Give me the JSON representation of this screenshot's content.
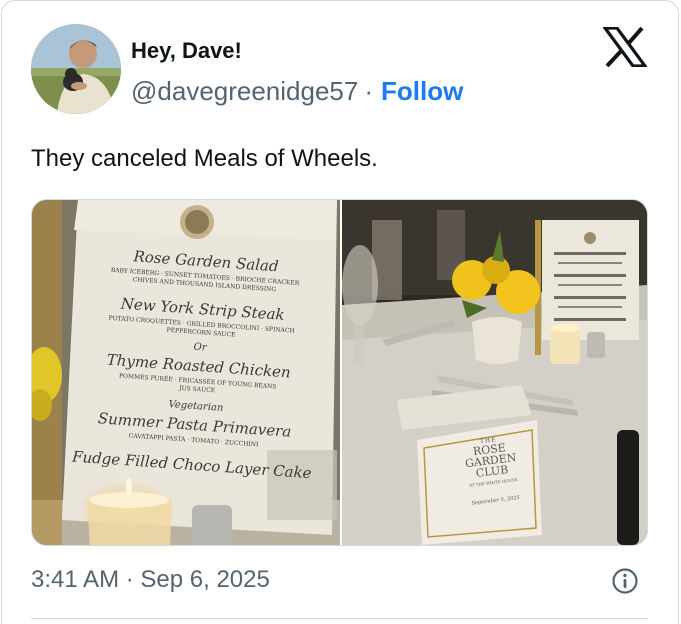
{
  "author": {
    "display_name": "Hey, Dave!",
    "handle": "@davegreenidge57",
    "separator": "·",
    "follow_label": "Follow"
  },
  "tweet": {
    "text": "They canceled Meals of Wheels.",
    "timestamp": "3:41 AM · Sep 6, 2025"
  },
  "menu_card": {
    "course1_title": "Rose Garden Salad",
    "course1_desc": "BABY ICEBERG · SUNSET TOMATOES · BRIOCHE CRACKER",
    "course1_desc2": "CHIVES AND THOUSAND ISLAND DRESSING",
    "course2_title": "New York Strip Steak",
    "course2_desc": "POTATO CROQUETTES · GRILLED BROCCOLINI · SPINACH",
    "course2_desc2": "PEPPERCORN SAUCE",
    "or_label": "Or",
    "course3_title": "Thyme Roasted Chicken",
    "course3_desc": "POMMES PURÉE · FRICASSÉE OF YOUNG BEANS",
    "course3_desc2": "JUS SAUCE",
    "veg_label": "Vegetarian",
    "course4_title": "Summer Pasta Primavera",
    "course4_desc": "CAVATAPPI PASTA · TOMATO · ZUCCHINI",
    "course5_title": "Fudge Filled Choco Layer Cake"
  },
  "table_card": {
    "line1": "THE",
    "line2": "ROSE",
    "line3": "GARDEN",
    "line4": "CLUB",
    "subtitle": "AT THE WHITE HOUSE",
    "date": "September 5, 2025"
  },
  "colors": {
    "follow_blue": "#1d7bf0",
    "secondary_text": "#536471",
    "border": "#cfd9de"
  },
  "icons": {
    "brand": "x-logo-icon",
    "info": "info-icon"
  }
}
